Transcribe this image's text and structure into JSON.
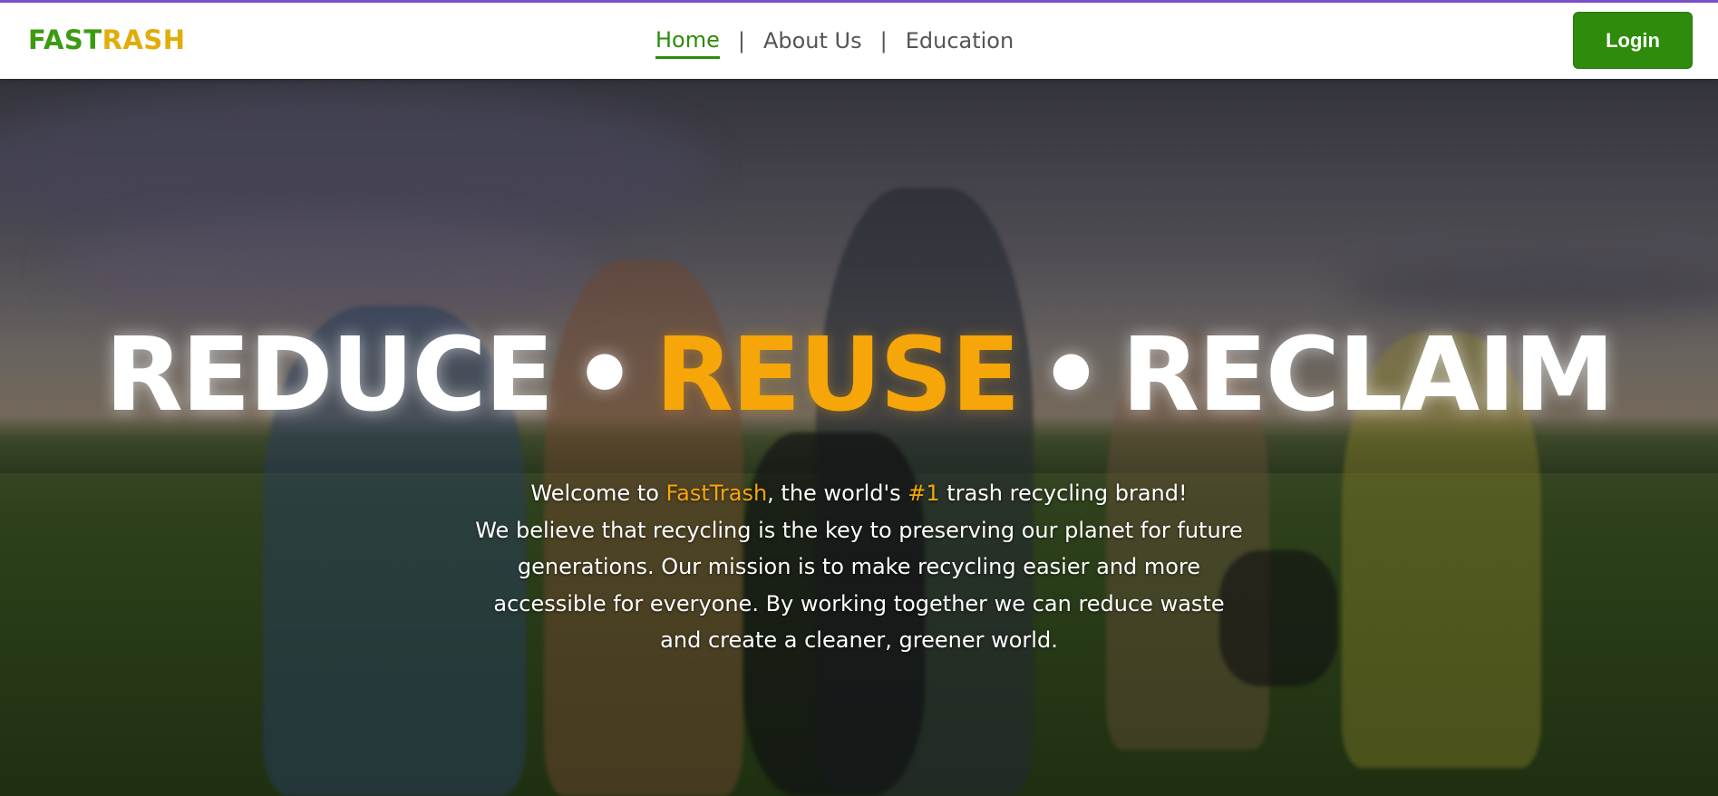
{
  "brand": {
    "part1": "FAST",
    "part2": "RASH",
    "full": "FASTRASH"
  },
  "nav": {
    "items": [
      {
        "label": "Home",
        "active": true
      },
      {
        "label": "About Us",
        "active": false
      },
      {
        "label": "Education",
        "active": false
      }
    ],
    "separator": "|"
  },
  "login_label": "Login",
  "hero": {
    "headline": {
      "word1": "REDUCE",
      "word2": "REUSE",
      "word3": "RECLAIM",
      "dot": "•"
    },
    "intro": {
      "prefix": "Welcome to ",
      "brand": "FastTrash",
      "mid": ", the world's ",
      "rank": "#1",
      "suffix": " trash recycling brand!",
      "body": "We believe that recycling is the key to preserving our planet for future generations. Our mission is to make recycling easier and more accessible for everyone. By working together we can reduce waste and create a cleaner, greener world."
    }
  },
  "colors": {
    "brand_green": "#3c9a12",
    "brand_yellow": "#e0ad0a",
    "accent_orange": "#f6a609",
    "button_green": "#2e8b0b",
    "top_accent": "#7b4fc8"
  }
}
